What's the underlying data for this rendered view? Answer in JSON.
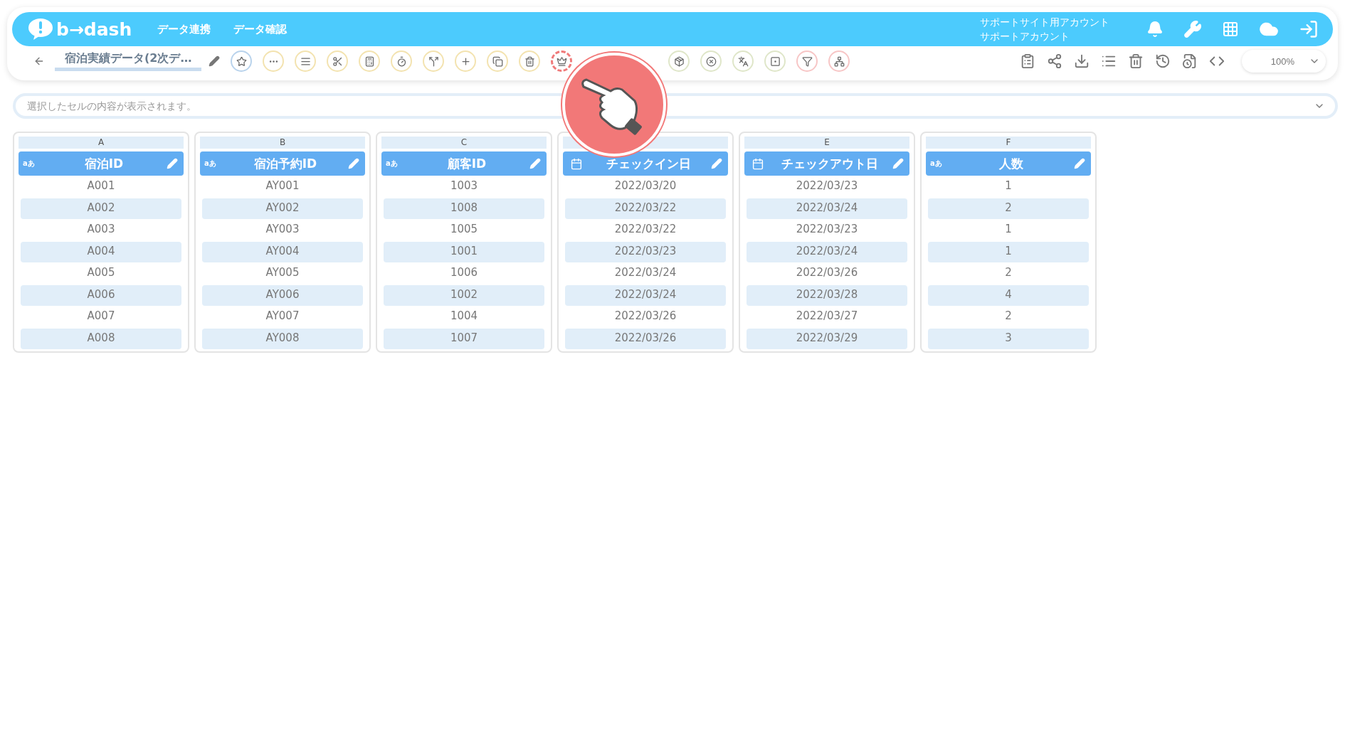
{
  "header": {
    "logo_text": "b→dash",
    "nav": [
      {
        "label": "データ連携"
      },
      {
        "label": "データ確認"
      }
    ],
    "account": {
      "line1": "サポートサイト用アカウント",
      "line2": "サポートアカウント"
    }
  },
  "toolbar": {
    "title": "宿泊実績データ(2次デ…",
    "tool_groups": [
      [
        {
          "kind": "star",
          "color": "#b9d3ec",
          "highlighted": false
        },
        {
          "kind": "dots",
          "color": "#f3e3b0",
          "highlighted": false
        },
        {
          "kind": "lines",
          "color": "#f3e3b0",
          "highlighted": false
        },
        {
          "kind": "scissors",
          "color": "#f3e3b0",
          "highlighted": false
        },
        {
          "kind": "calc",
          "color": "#f3e3b0",
          "highlighted": false
        },
        {
          "kind": "timer",
          "color": "#f3e3b0",
          "highlighted": false
        },
        {
          "kind": "split",
          "color": "#f3e3b0",
          "highlighted": false
        },
        {
          "kind": "plus",
          "color": "#f3e3b0",
          "highlighted": false
        },
        {
          "kind": "copy",
          "color": "#f3e3b0",
          "highlighted": false
        },
        {
          "kind": "trash",
          "color": "#f3e3b0",
          "highlighted": false
        },
        {
          "kind": "crown",
          "color": "#f07a7a",
          "highlighted": true
        }
      ],
      [
        {
          "kind": "package",
          "color": "#dfe6c9",
          "highlighted": false
        },
        {
          "kind": "xcircle",
          "color": "#dfe6c9",
          "highlighted": false
        },
        {
          "kind": "translate",
          "color": "#dfe6c9",
          "highlighted": false
        },
        {
          "kind": "square",
          "color": "#dfe6c9",
          "highlighted": false
        },
        {
          "kind": "filter",
          "color": "#f7c6c6",
          "highlighted": false
        },
        {
          "kind": "network",
          "color": "#f7c6c6",
          "highlighted": false
        }
      ]
    ],
    "actions": [
      {
        "kind": "clipboard"
      },
      {
        "kind": "share"
      },
      {
        "kind": "download"
      },
      {
        "kind": "list"
      },
      {
        "kind": "trash"
      },
      {
        "kind": "history"
      },
      {
        "kind": "file"
      },
      {
        "kind": "code"
      }
    ],
    "zoom": "100%"
  },
  "formula_bar": {
    "placeholder": "選択したセルの内容が表示されます。"
  },
  "columns": [
    {
      "letter": "A",
      "title": "宿泊ID",
      "kind": "text",
      "type_label": "aあ",
      "cells": [
        "A001",
        "A002",
        "A003",
        "A004",
        "A005",
        "A006",
        "A007",
        "A008"
      ]
    },
    {
      "letter": "B",
      "title": "宿泊予約ID",
      "kind": "text",
      "type_label": "aあ",
      "cells": [
        "AY001",
        "AY002",
        "AY003",
        "AY004",
        "AY005",
        "AY006",
        "AY007",
        "AY008"
      ]
    },
    {
      "letter": "C",
      "title": "顧客ID",
      "kind": "text",
      "type_label": "aあ",
      "cells": [
        "1003",
        "1008",
        "1005",
        "1001",
        "1006",
        "1002",
        "1004",
        "1007"
      ]
    },
    {
      "title": "チェックイン日",
      "kind": "date",
      "cells": [
        "2022/03/20",
        "2022/03/22",
        "2022/03/22",
        "2022/03/23",
        "2022/03/24",
        "2022/03/24",
        "2022/03/26",
        "2022/03/26"
      ]
    },
    {
      "letter": "E",
      "title": "チェックアウト日",
      "kind": "date",
      "cells": [
        "2022/03/23",
        "2022/03/24",
        "2022/03/23",
        "2022/03/24",
        "2022/03/26",
        "2022/03/28",
        "2022/03/27",
        "2022/03/29"
      ]
    },
    {
      "letter": "F",
      "title": "人数",
      "kind": "text",
      "type_label": "aあ",
      "cells": [
        "1",
        "2",
        "1",
        "1",
        "2",
        "4",
        "2",
        "3"
      ]
    }
  ]
}
